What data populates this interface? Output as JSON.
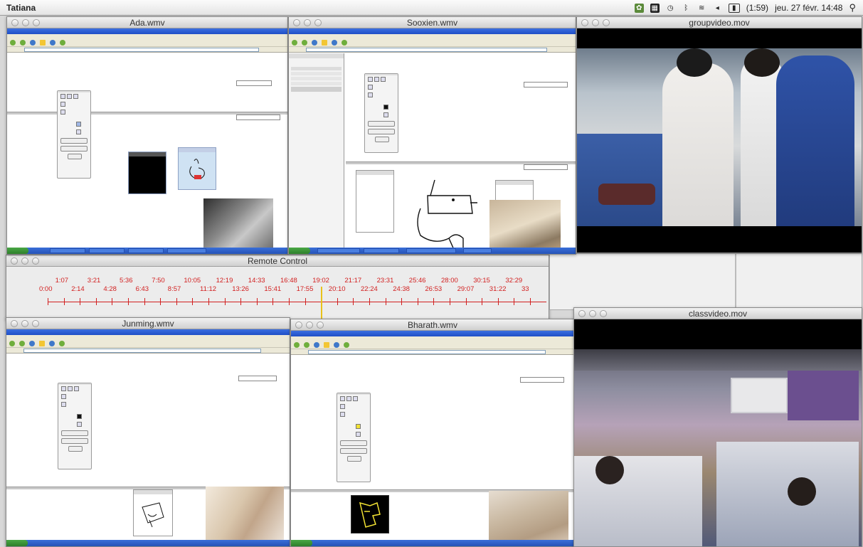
{
  "menubar": {
    "user": "Tatiana",
    "battery": "(1:59)",
    "clock": "jeu. 27 févr.  14:48"
  },
  "windows": {
    "ada": {
      "title": "Ada.wmv"
    },
    "sooxien": {
      "title": "Sooxien.wmv"
    },
    "groupvideo": {
      "title": "groupvideo.mov"
    },
    "remote": {
      "title": "Remote Control"
    },
    "junming": {
      "title": "Junming.wmv"
    },
    "bharath": {
      "title": "Bharath.wmv"
    },
    "classvideo": {
      "title": "classvideo.mov"
    }
  },
  "timeline": {
    "upper": [
      "1:07",
      "3:21",
      "5:36",
      "7:50",
      "10:05",
      "12:19",
      "14:33",
      "16:48",
      "19:02",
      "21:17",
      "23:31",
      "25:46",
      "28:00",
      "30:15",
      "32:29"
    ],
    "lower": [
      "0:00",
      "2:14",
      "4:28",
      "6:43",
      "8:57",
      "11:12",
      "13:26",
      "15:41",
      "17:55",
      "20:10",
      "22:24",
      "24:38",
      "26:53",
      "29:07",
      "31:22",
      "33"
    ],
    "playhead_time": "19:02",
    "color": "#d21f1f",
    "playhead_color": "#e8c21a"
  }
}
